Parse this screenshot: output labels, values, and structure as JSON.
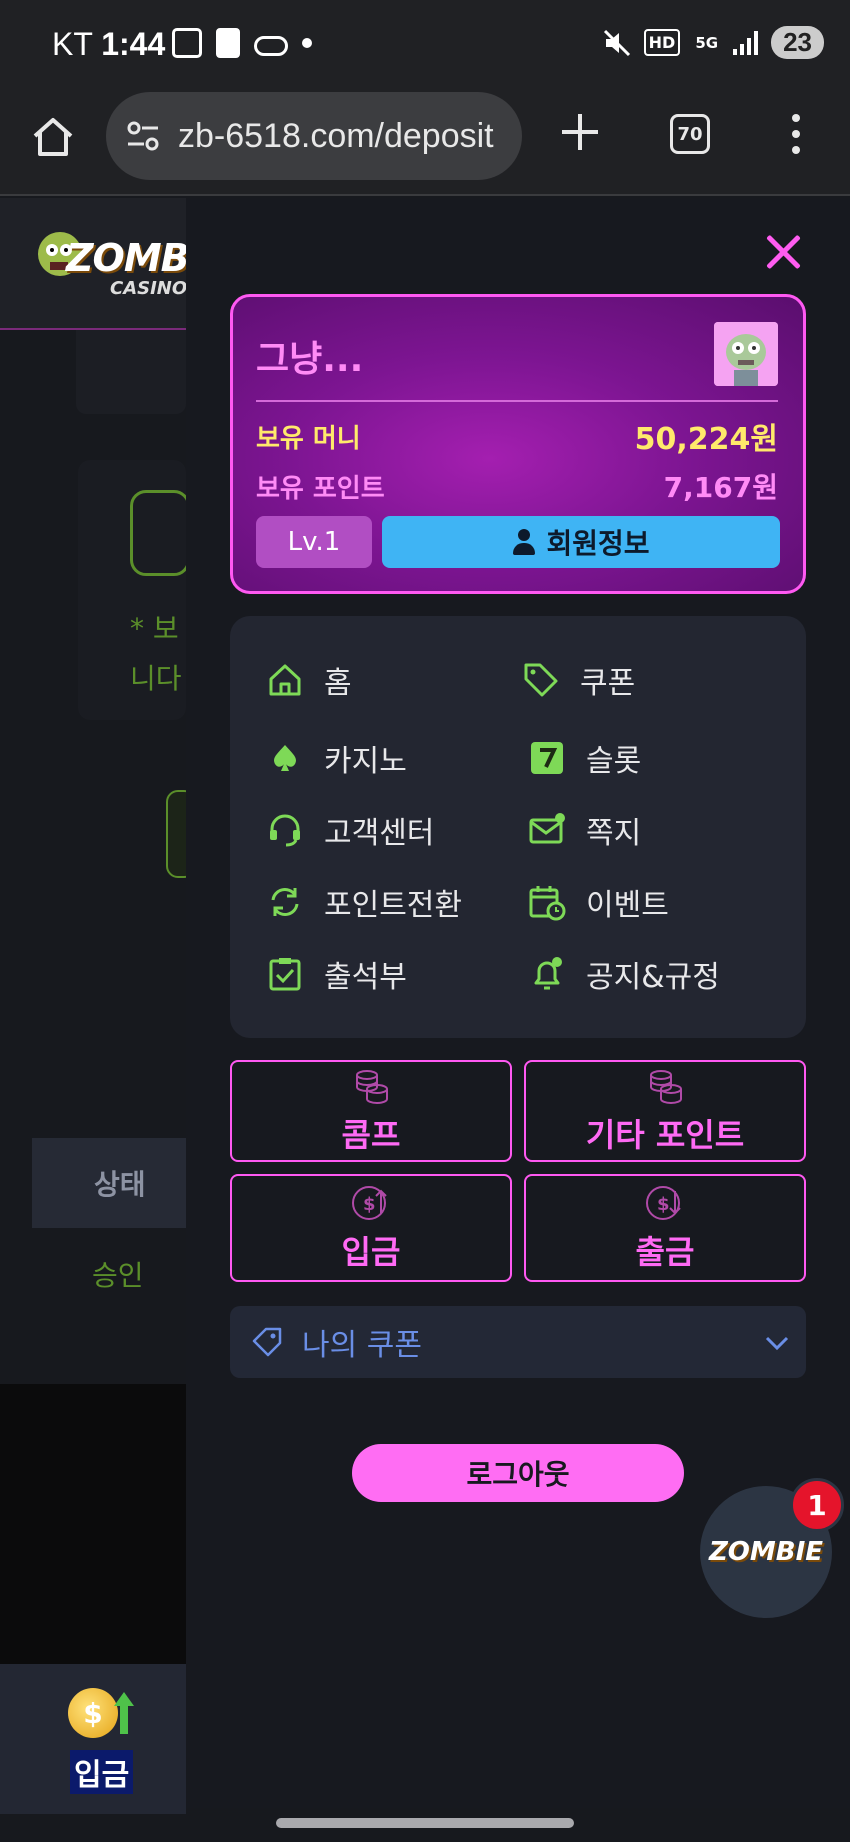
{
  "status_bar": {
    "carrier": "KT",
    "time": "1:44",
    "network_label": "HD",
    "network_5g": "5G",
    "battery": "23"
  },
  "browser": {
    "url": "zb-6518.com/deposit",
    "tab_count": "70"
  },
  "background_page": {
    "logo_text": "ZOMBIE",
    "logo_sub": "CASINO",
    "note_text": "* 보\n니다",
    "table_header": "상태",
    "table_cell": "승인",
    "bottom_nav_deposit": "입금"
  },
  "drawer": {
    "profile": {
      "name": "그냥...",
      "money_label": "보유 머니",
      "money_value": "50,224원",
      "points_label": "보유 포인트",
      "points_value": "7,167원",
      "level": "Lv.1",
      "member_info_button": "회원정보"
    },
    "menu": [
      {
        "label": "홈",
        "icon": "home-icon"
      },
      {
        "label": "쿠폰",
        "icon": "tag-icon"
      },
      {
        "label": "카지노",
        "icon": "spade-icon"
      },
      {
        "label": "슬롯",
        "icon": "seven-icon"
      },
      {
        "label": "고객센터",
        "icon": "headset-icon"
      },
      {
        "label": "쪽지",
        "icon": "mail-icon"
      },
      {
        "label": "포인트전환",
        "icon": "refresh-icon"
      },
      {
        "label": "이벤트",
        "icon": "calendar-clock-icon"
      },
      {
        "label": "출석부",
        "icon": "clipboard-check-icon"
      },
      {
        "label": "공지&규정",
        "icon": "bell-icon"
      }
    ],
    "tiles": [
      {
        "label": "콤프",
        "icon": "coins-icon"
      },
      {
        "label": "기타 포인트",
        "icon": "coins-icon"
      },
      {
        "label": "입금",
        "icon": "dollar-up-icon"
      },
      {
        "label": "출금",
        "icon": "dollar-down-icon"
      }
    ],
    "my_coupon": "나의 쿠폰",
    "logout": "로그아웃",
    "fab_text": "ZOMBIE",
    "fab_badge": "1"
  },
  "colors": {
    "accent_pink": "#ff59f2",
    "accent_green": "#8cf23a",
    "yellow": "#ffe96b",
    "blue_button": "#3fb4f4"
  }
}
